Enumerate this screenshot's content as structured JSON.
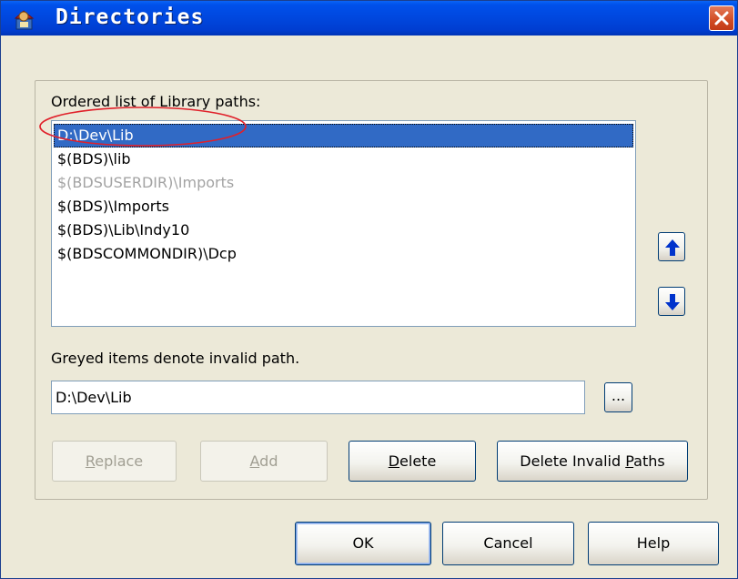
{
  "window": {
    "title": "Directories",
    "icon": "app-icon",
    "close_icon": "close-icon"
  },
  "list": {
    "caption": "Ordered list of Library paths:",
    "items": [
      {
        "text": "D:\\Dev\\Lib",
        "state": "selected"
      },
      {
        "text": "$(BDS)\\lib",
        "state": "valid"
      },
      {
        "text": "$(BDSUSERDIR)\\Imports",
        "state": "invalid"
      },
      {
        "text": "$(BDS)\\Imports",
        "state": "valid"
      },
      {
        "text": "$(BDS)\\Lib\\Indy10",
        "state": "valid"
      },
      {
        "text": "$(BDSCOMMONDIR)\\Dcp",
        "state": "valid"
      }
    ],
    "annotation_color": "#e0202a"
  },
  "note": "Greyed items denote invalid path.",
  "path_input": {
    "value": "D:\\Dev\\Lib"
  },
  "browse_label": "...",
  "buttons": {
    "replace": {
      "pre": "",
      "u": "R",
      "post": "eplace"
    },
    "add": {
      "pre": "",
      "u": "A",
      "post": "dd"
    },
    "delete": {
      "pre": "",
      "u": "D",
      "post": "elete"
    },
    "delete_invalid": {
      "pre": "Delete Invalid ",
      "u": "P",
      "post": "aths"
    },
    "ok": "OK",
    "cancel": "Cancel",
    "help": "Help"
  },
  "colors": {
    "titlebar": "#0047de",
    "selection": "#316ac5",
    "invalid_text": "#a3a3a3",
    "arrow": "#0033cc"
  }
}
